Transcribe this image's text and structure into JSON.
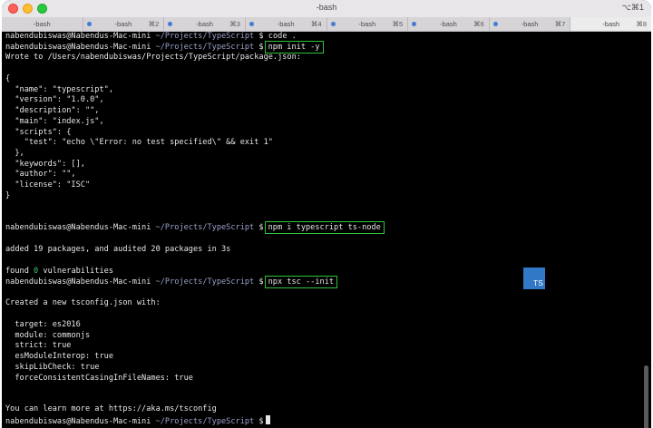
{
  "window": {
    "title": "-bash",
    "shortcut": "⌥⌘1"
  },
  "tabs": [
    {
      "label": "-bash",
      "shortcut": "",
      "dot": false,
      "active": false
    },
    {
      "label": "-bash",
      "shortcut": "⌘2",
      "dot": true,
      "active": false
    },
    {
      "label": "-bash",
      "shortcut": "⌘3",
      "dot": true,
      "active": false
    },
    {
      "label": "-bash",
      "shortcut": "⌘4",
      "dot": true,
      "active": false
    },
    {
      "label": "-bash",
      "shortcut": "⌘5",
      "dot": true,
      "active": false
    },
    {
      "label": "-bash",
      "shortcut": "⌘6",
      "dot": true,
      "active": false
    },
    {
      "label": "-bash",
      "shortcut": "⌘7",
      "dot": true,
      "active": false
    },
    {
      "label": "-bash",
      "shortcut": "⌘8",
      "dot": false,
      "active": true
    }
  ],
  "prompt": {
    "user": "nabendubiswas@Nabendus-Mac-mini",
    "cwd": "~/Projects/TypeScript",
    "symbol": "$"
  },
  "commands": {
    "code": "code .",
    "npm_init": "npm init -y",
    "npm_install": "npm i typescript ts-node",
    "tsc_init": "npx tsc --init"
  },
  "output": {
    "wrote": "Wrote to /Users/nabendubiswas/Projects/TypeScript/package.json:",
    "package_json": [
      "{",
      "  \"name\": \"typescript\",",
      "  \"version\": \"1.0.0\",",
      "  \"description\": \"\",",
      "  \"main\": \"index.js\",",
      "  \"scripts\": {",
      "    \"test\": \"echo \\\"Error: no test specified\\\" && exit 1\"",
      "  },",
      "  \"keywords\": [],",
      "  \"author\": \"\",",
      "  \"license\": \"ISC\"",
      "}"
    ],
    "added": "added 19 packages, and audited 20 packages in 3s",
    "found_prefix": "found ",
    "found_count": "0",
    "found_suffix": " vulnerabilities",
    "created": "Created a new tsconfig.json with:",
    "tsconfig": [
      "  target: es2016",
      "  module: commonjs",
      "  strict: true",
      "  esModuleInterop: true",
      "  skipLibCheck: true",
      "  forceConsistentCasingInFileNames: true"
    ],
    "learn_more": "You can learn more at https://aka.ms/tsconfig"
  },
  "overlay": {
    "ts_logo": "TS"
  },
  "colors": {
    "terminal_bg": "#000000",
    "terminal_fg": "#e6e6e6",
    "cwd": "#9aa0c8",
    "highlight_box": "#31c23a",
    "vulnerability_count": "#3fc96b",
    "ts_logo_bg": "#3178c6"
  }
}
